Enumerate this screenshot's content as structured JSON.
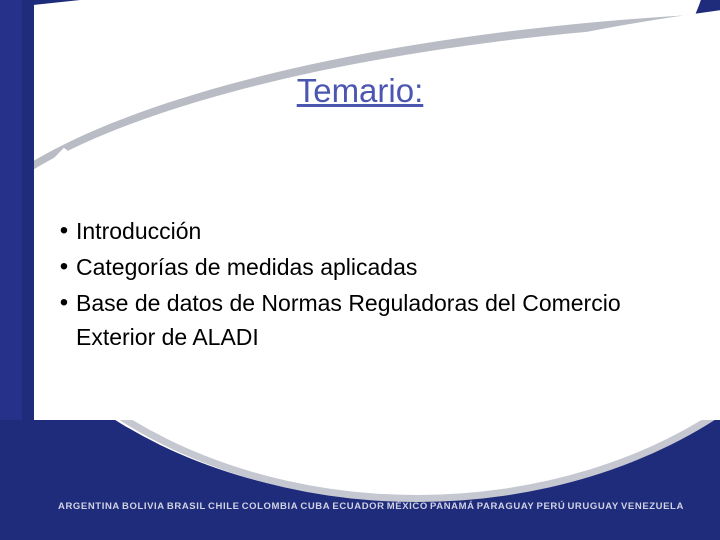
{
  "slide": {
    "title": "Temario:",
    "bullets": [
      "Introducción",
      "Categorías de medidas aplicadas",
      "Base de datos de Normas Reguladoras del Comercio Exterior de ALADI"
    ],
    "bullet_marker": "•",
    "footer_countries": [
      "ARGENTINA",
      "BOLIVIA",
      "BRASIL",
      "CHILE",
      "COLOMBIA",
      "CUBA",
      "ECUADOR",
      "MÉXICO",
      "PANAMÁ",
      "PARAGUAY",
      "PERÚ",
      "URUGUAY",
      "VENEZUELA"
    ],
    "colors": {
      "navy": "#1f2b7b",
      "title": "#4a56b0",
      "grey_swoosh": "#b9bcc4",
      "footer_text": "#cfd3e4"
    }
  }
}
